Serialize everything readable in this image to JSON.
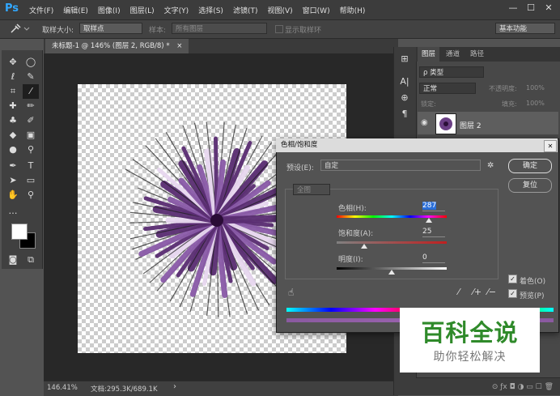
{
  "app": {
    "logo": "Ps"
  },
  "menu": [
    "文件(F)",
    "编辑(E)",
    "图像(I)",
    "图层(L)",
    "文字(Y)",
    "选择(S)",
    "滤镜(T)",
    "视图(V)",
    "窗口(W)",
    "帮助(H)"
  ],
  "window_controls": {
    "minimize": "—",
    "restore": "☐",
    "close": "✕"
  },
  "options": {
    "sample_size_label": "取样大小:",
    "sample_size_value": "取样点",
    "sample_label": "样本:",
    "sample_value": "所有图层",
    "show_ring": "显示取样环",
    "workspace": "基本功能"
  },
  "document": {
    "tab_title": "未标题-1 @ 146% (图层 2, RGB/8) *",
    "close": "×"
  },
  "status": {
    "zoom": "146.41%",
    "doc": "文档:295.3K/689.1K",
    "arrow": "›"
  },
  "layers_panel": {
    "tabs": [
      "图层",
      "通道",
      "路径"
    ],
    "filter_label": "ρ 类型",
    "blend_mode": "正常",
    "opacity_label": "不透明度:",
    "opacity_value": "100%",
    "lock_label": "锁定:",
    "fill_label": "填充:",
    "fill_value": "100%",
    "layer_name": "图层 2"
  },
  "dialog": {
    "title": "色相/饱和度",
    "preset_label": "预设(E):",
    "preset_value": "自定",
    "channel": "全图",
    "hue_label": "色相(H):",
    "hue_value": "287",
    "hue_fraction": 0.84,
    "sat_label": "饱和度(A):",
    "sat_value": "25",
    "sat_fraction": 0.25,
    "light_label": "明度(I):",
    "light_value": "0",
    "light_fraction": 0.5,
    "ok": "确定",
    "reset": "复位",
    "colorize": "着色(O)",
    "preview": "预览(P)",
    "close": "✕"
  },
  "watermark": {
    "main": "百科全说",
    "sub": "助你轻松解决"
  }
}
